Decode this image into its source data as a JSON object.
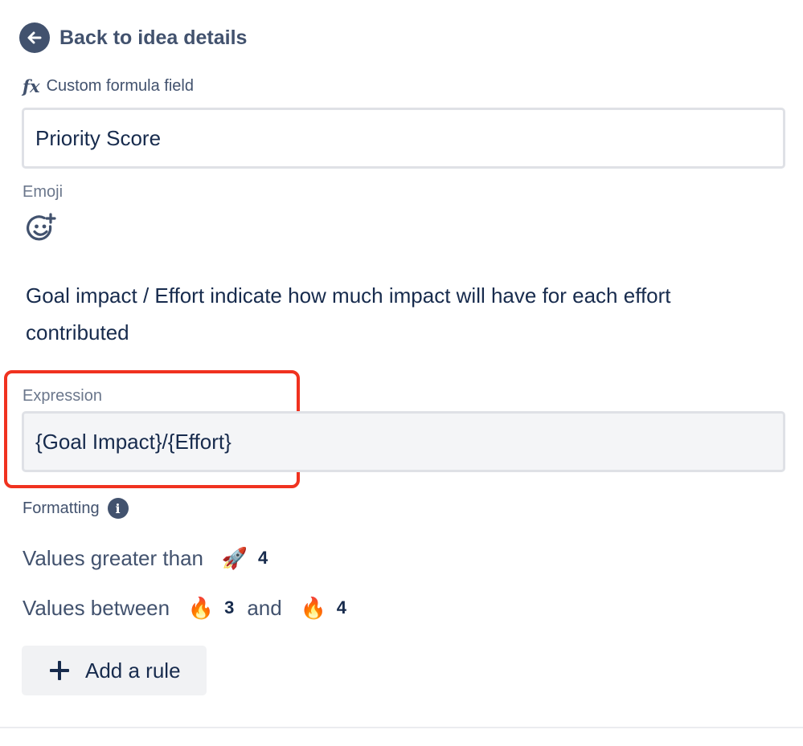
{
  "back_link": {
    "label": "Back to idea details",
    "icon": "arrow-left-circle-icon"
  },
  "field": {
    "type_label": "Custom formula field",
    "type_icon": "fx-icon",
    "name_value": "Priority Score",
    "emoji_label": "Emoji",
    "emoji_icon": "add-emoji-icon"
  },
  "description": "Goal impact / Effort indicate how much impact will have for each effort contributed",
  "expression": {
    "label": "Expression",
    "value": "{Goal Impact}/{Effort}",
    "highlight_color": "#f0321f"
  },
  "formatting": {
    "label": "Formatting",
    "info_icon": "info-icon",
    "rules": [
      {
        "prefix": "Values greater than",
        "emoji": "🚀",
        "emoji_name": "rocket-icon",
        "value": "4"
      },
      {
        "prefix": "Values between",
        "emoji": "🔥",
        "emoji_name": "fire-icon",
        "value": "3",
        "joiner": "and",
        "emoji2": "🔥",
        "value2": "4"
      }
    ],
    "add_rule_label": "Add a rule"
  },
  "colors": {
    "text_primary": "#172b4d",
    "text_secondary": "#42526e",
    "text_subtle": "#6b778c",
    "border": "#dfe1e6"
  }
}
